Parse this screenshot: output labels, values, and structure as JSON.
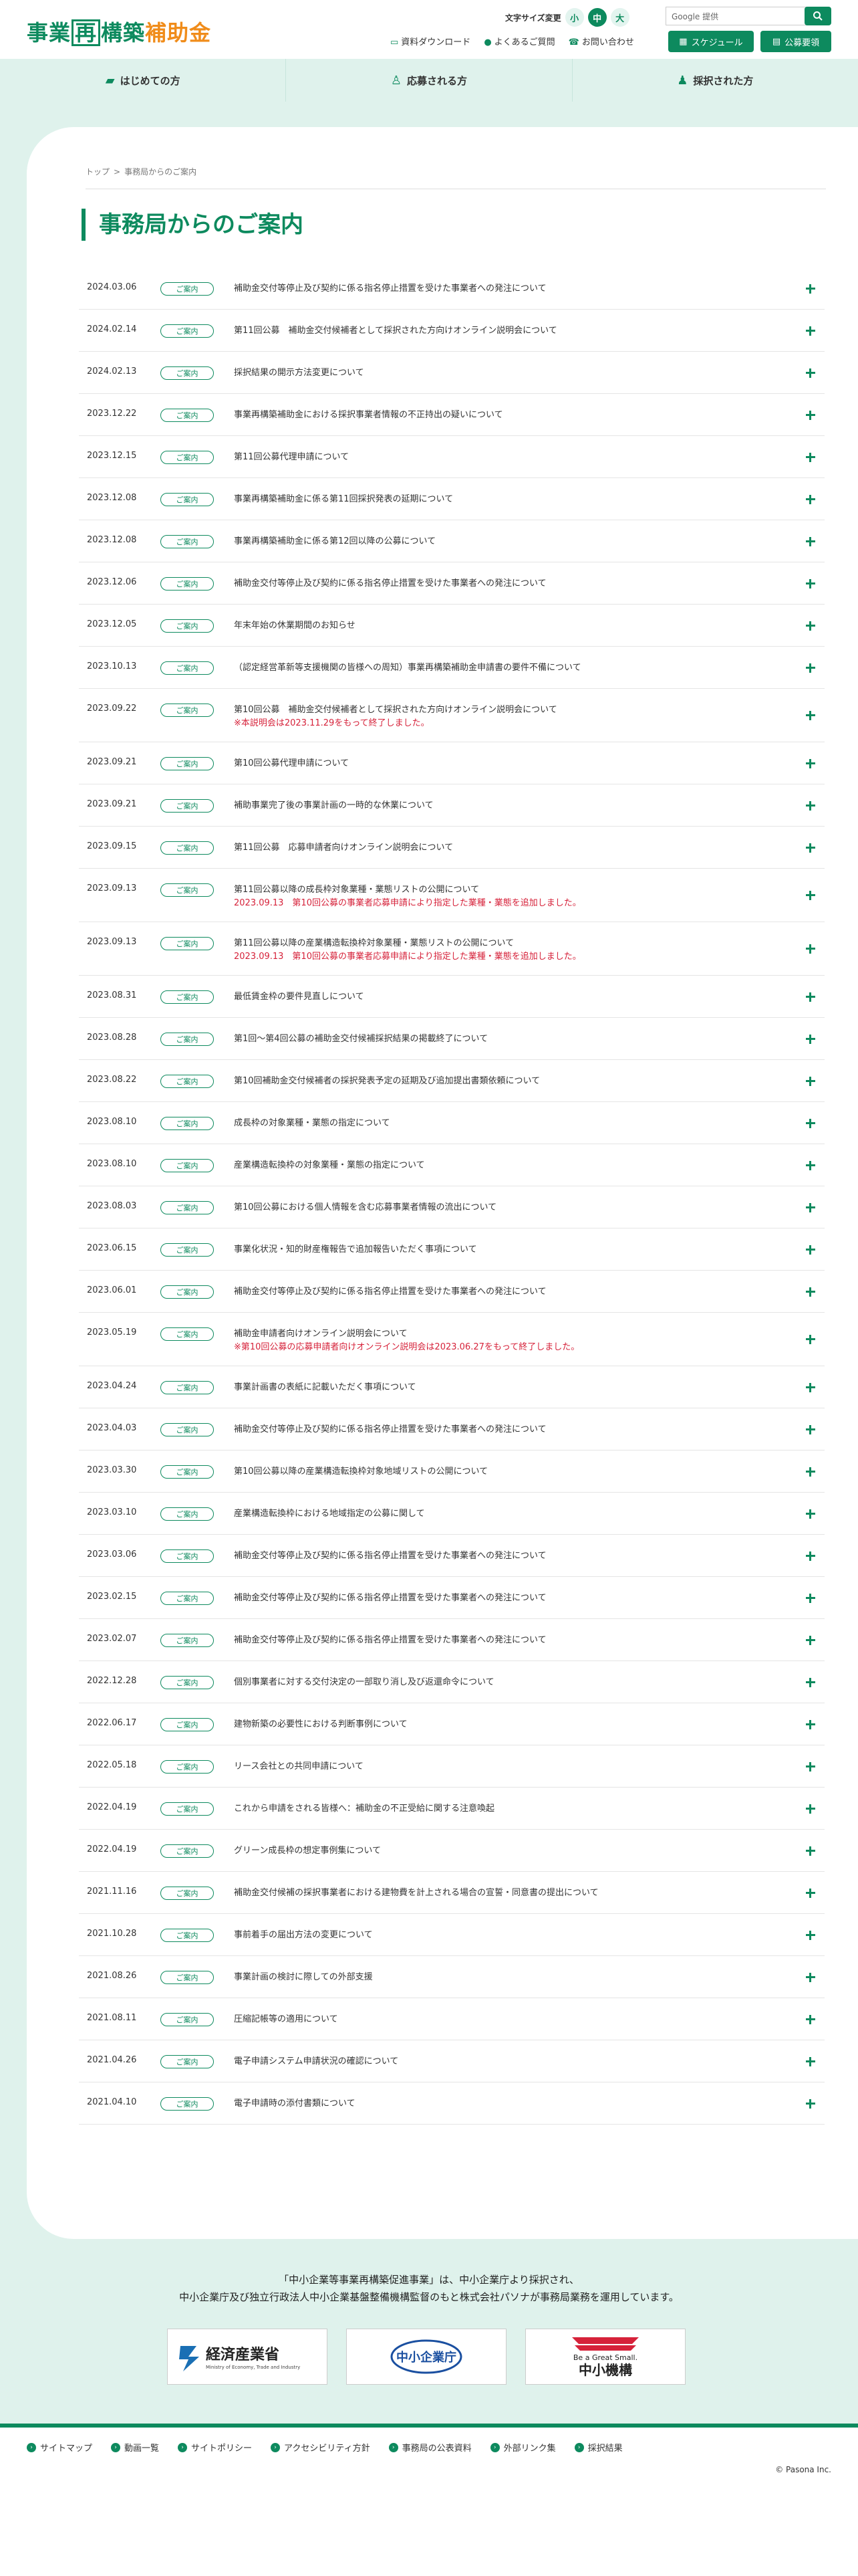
{
  "header": {
    "logo_green": "事業",
    "logo_boxed": "再",
    "logo_green2": "構築",
    "logo_orange": "補助金",
    "fontsize_label": "文字サイズ変更",
    "fontsize_options": [
      "小",
      "中",
      "大"
    ],
    "search_placeholder": "Google 提供",
    "links": [
      "資料ダウンロード",
      "よくあるご質問",
      "お問い合わせ"
    ],
    "schedule_button": "スケジュール",
    "koubo_button": "公募要領"
  },
  "gnav": [
    "はじめての方",
    "応募される方",
    "採択された方"
  ],
  "breadcrumb": [
    "トップ",
    "事務局からのご案内"
  ],
  "page_title": "事務局からのご案内",
  "badge_label": "ご案内",
  "news": [
    {
      "date": "2024.03.06",
      "text": "補助金交付等停止及び契約に係る指名停止措置を受けた事業者への発注について",
      "sub": ""
    },
    {
      "date": "2024.02.14",
      "text": "第11回公募　補助金交付候補者として採択された方向けオンライン説明会について",
      "sub": ""
    },
    {
      "date": "2024.02.13",
      "text": "採択結果の開示方法変更について",
      "sub": ""
    },
    {
      "date": "2023.12.22",
      "text": "事業再構築補助金における採択事業者情報の不正持出の疑いについて",
      "sub": ""
    },
    {
      "date": "2023.12.15",
      "text": "第11回公募代理申請について",
      "sub": ""
    },
    {
      "date": "2023.12.08",
      "text": "事業再構築補助金に係る第11回採択発表の延期について",
      "sub": ""
    },
    {
      "date": "2023.12.08",
      "text": "事業再構築補助金に係る第12回以降の公募について",
      "sub": ""
    },
    {
      "date": "2023.12.06",
      "text": "補助金交付等停止及び契約に係る指名停止措置を受けた事業者への発注について",
      "sub": ""
    },
    {
      "date": "2023.12.05",
      "text": "年末年始の休業期間のお知らせ",
      "sub": ""
    },
    {
      "date": "2023.10.13",
      "text": "（認定経営革新等支援機関の皆様への周知）事業再構築補助金申請書の要件不備について",
      "sub": ""
    },
    {
      "date": "2023.09.22",
      "text": "第10回公募　補助金交付候補者として採択された方向けオンライン説明会について",
      "sub": "※本説明会は2023.11.29をもって終了しました。"
    },
    {
      "date": "2023.09.21",
      "text": "第10回公募代理申請について",
      "sub": ""
    },
    {
      "date": "2023.09.21",
      "text": "補助事業完了後の事業計画の一時的な休業について",
      "sub": ""
    },
    {
      "date": "2023.09.15",
      "text": "第11回公募　応募申請者向けオンライン説明会について",
      "sub": ""
    },
    {
      "date": "2023.09.13",
      "text": "第11回公募以降の成長枠対象業種・業態リストの公開について",
      "sub": "2023.09.13　第10回公募の事業者応募申請により指定した業種・業態を追加しました。"
    },
    {
      "date": "2023.09.13",
      "text": "第11回公募以降の産業構造転換枠対象業種・業態リストの公開について",
      "sub": "2023.09.13　第10回公募の事業者応募申請により指定した業種・業態を追加しました。"
    },
    {
      "date": "2023.08.31",
      "text": "最低賃金枠の要件見直しについて",
      "sub": ""
    },
    {
      "date": "2023.08.28",
      "text": "第1回〜第4回公募の補助金交付候補採択結果の掲載終了について",
      "sub": ""
    },
    {
      "date": "2023.08.22",
      "text": "第10回補助金交付候補者の採択発表予定の延期及び追加提出書類依頼について",
      "sub": ""
    },
    {
      "date": "2023.08.10",
      "text": "成長枠の対象業種・業態の指定について",
      "sub": ""
    },
    {
      "date": "2023.08.10",
      "text": "産業構造転換枠の対象業種・業態の指定について",
      "sub": ""
    },
    {
      "date": "2023.08.03",
      "text": "第10回公募における個人情報を含む応募事業者情報の流出について",
      "sub": ""
    },
    {
      "date": "2023.06.15",
      "text": "事業化状況・知的財産権報告で追加報告いただく事項について",
      "sub": ""
    },
    {
      "date": "2023.06.01",
      "text": "補助金交付等停止及び契約に係る指名停止措置を受けた事業者への発注について",
      "sub": ""
    },
    {
      "date": "2023.05.19",
      "text": "補助金申請者向けオンライン説明会について",
      "sub": "※第10回公募の応募申請者向けオンライン説明会は2023.06.27をもって終了しました。"
    },
    {
      "date": "2023.04.24",
      "text": "事業計画書の表紙に記載いただく事項について",
      "sub": ""
    },
    {
      "date": "2023.04.03",
      "text": "補助金交付等停止及び契約に係る指名停止措置を受けた事業者への発注について",
      "sub": ""
    },
    {
      "date": "2023.03.30",
      "text": "第10回公募以降の産業構造転換枠対象地域リストの公開について",
      "sub": ""
    },
    {
      "date": "2023.03.10",
      "text": "産業構造転換枠における地域指定の公募に関して",
      "sub": ""
    },
    {
      "date": "2023.03.06",
      "text": "補助金交付等停止及び契約に係る指名停止措置を受けた事業者への発注について",
      "sub": ""
    },
    {
      "date": "2023.02.15",
      "text": "補助金交付等停止及び契約に係る指名停止措置を受けた事業者への発注について",
      "sub": ""
    },
    {
      "date": "2023.02.07",
      "text": "補助金交付等停止及び契約に係る指名停止措置を受けた事業者への発注について",
      "sub": ""
    },
    {
      "date": "2022.12.28",
      "text": "個別事業者に対する交付決定の一部取り消し及び返還命令について",
      "sub": ""
    },
    {
      "date": "2022.06.17",
      "text": "建物新築の必要性における判断事例について",
      "sub": ""
    },
    {
      "date": "2022.05.18",
      "text": "リース会社との共同申請について",
      "sub": ""
    },
    {
      "date": "2022.04.19",
      "text": "これから申請をされる皆様へ：補助金の不正受給に関する注意喚起",
      "sub": ""
    },
    {
      "date": "2022.04.19",
      "text": "グリーン成長枠の想定事例集について",
      "sub": ""
    },
    {
      "date": "2021.11.16",
      "text": "補助金交付候補の採択事業者における建物費を計上される場合の宣誓・同意書の提出について",
      "sub": ""
    },
    {
      "date": "2021.10.28",
      "text": "事前着手の届出方法の変更について",
      "sub": ""
    },
    {
      "date": "2021.08.26",
      "text": "事業計画の検討に際しての外部支援",
      "sub": ""
    },
    {
      "date": "2021.08.11",
      "text": "圧縮記帳等の適用について",
      "sub": ""
    },
    {
      "date": "2021.04.26",
      "text": "電子申請システム申請状況の確認について",
      "sub": ""
    },
    {
      "date": "2021.04.10",
      "text": "電子申請時の添付書類について",
      "sub": ""
    }
  ],
  "footer": {
    "line1": "「中小企業等事業再構築促進事業」は、中小企業庁より採択され、",
    "line2": "中小企業庁及び独立行政法人中小企業基盤整備機構監督のもと株式会社パソナが事務局業務を運用しています。",
    "logo_meti_jp": "経済産業省",
    "logo_meti_en": "Ministry of Economy, Trade and Industry",
    "logo_chusho": "中小企業庁",
    "logo_smrj_en": "Be a Great Small.",
    "logo_smrj_jp": "中小機構",
    "nav": [
      "サイトマップ",
      "動画一覧",
      "サイトポリシー",
      "アクセシビリティ方針",
      "事務局の公表資料",
      "外部リンク集",
      "採択結果"
    ],
    "copyright": "© Pasona Inc."
  },
  "colors": {
    "brand": "#0d8a5e",
    "accent": "#f08c1a",
    "alert": "#d6223a",
    "bg": "#dff2ec"
  }
}
